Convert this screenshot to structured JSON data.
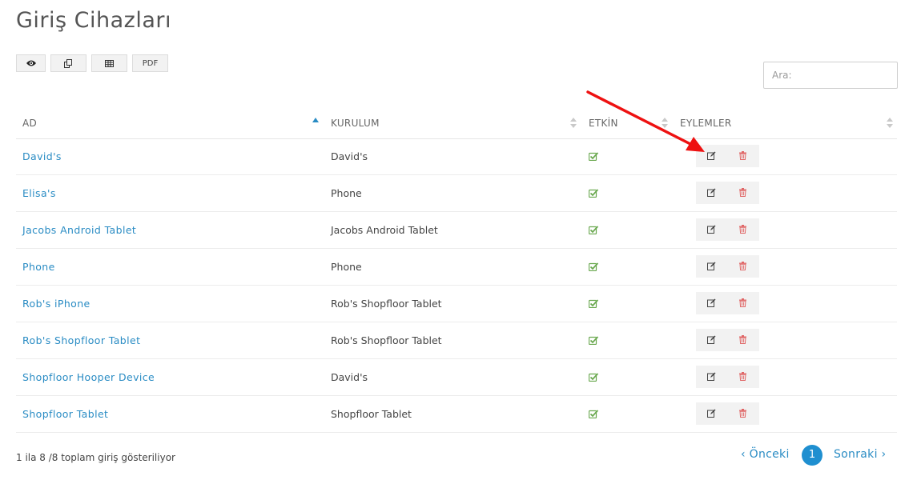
{
  "page": {
    "title": "Giriş Cihazları"
  },
  "toolbar": {
    "buttons": [
      {
        "name": "view-button",
        "icon": "eye-icon"
      },
      {
        "name": "copy-button",
        "icon": "copy-icon"
      },
      {
        "name": "excel-button",
        "icon": "table-icon"
      },
      {
        "name": "pdf-button",
        "label": "PDF"
      }
    ]
  },
  "search": {
    "placeholder": "Ara:",
    "value": ""
  },
  "table": {
    "columns": [
      "AD",
      "KURULUM",
      "ETKİN",
      "EYLEMLER"
    ],
    "rows": [
      {
        "name": "David's",
        "kurulum": "David's",
        "active": true
      },
      {
        "name": "Elisa's",
        "kurulum": "Phone",
        "active": true
      },
      {
        "name": "Jacobs Android Tablet",
        "kurulum": "Jacobs Android Tablet",
        "active": true
      },
      {
        "name": "Phone",
        "kurulum": "Phone",
        "active": true
      },
      {
        "name": "Rob's iPhone",
        "kurulum": "Rob's Shopfloor Tablet",
        "active": true
      },
      {
        "name": "Rob's Shopfloor Tablet",
        "kurulum": "Rob's Shopfloor Tablet",
        "active": true
      },
      {
        "name": "Shopfloor Hooper Device",
        "kurulum": "David's",
        "active": true
      },
      {
        "name": "Shopfloor Tablet",
        "kurulum": "Shopfloor Tablet",
        "active": true
      }
    ]
  },
  "footer": {
    "info": "1 ila 8 /8 toplam giriş gösteriliyor",
    "prev": "‹ Önceki",
    "current_page": "1",
    "next": "Sonraki ›"
  },
  "colors": {
    "link": "#2a8cc4",
    "check": "#6aa84f",
    "delete": "#e06666",
    "page_active": "#1f8fd0",
    "annotation_arrow": "#ee1111"
  }
}
